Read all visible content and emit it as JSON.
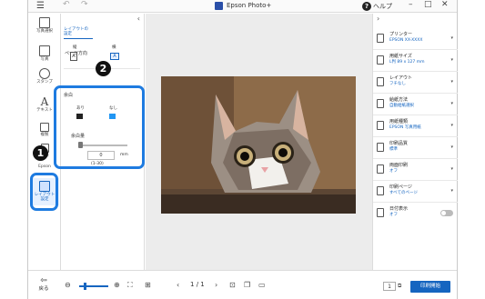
{
  "titlebar": {
    "app_title": "Epson Photo+",
    "help_label": "ヘルプ",
    "menu_icon": "hamburger-menu-icon",
    "undo_icon": "undo-icon",
    "redo_icon": "redo-icon"
  },
  "left_toolbar": {
    "items": [
      {
        "label": "写真選択",
        "icon": "photo-select-icon"
      },
      {
        "label": "写真",
        "icon": "photo-add-icon"
      },
      {
        "label": "スタンプ",
        "icon": "stamp-icon"
      },
      {
        "label": "テキスト",
        "icon": "text-icon"
      },
      {
        "label": "複製",
        "icon": "duplicate-icon"
      },
      {
        "label": "削除",
        "icon": "delete-icon"
      },
      {
        "label": "Epson",
        "icon": "epson-icon"
      },
      {
        "label": "レイアウト\n設定",
        "icon": "layout-settings-icon",
        "selected": true
      }
    ]
  },
  "settings_panel": {
    "tab_label": "レイアウトの\n設定",
    "orientation": {
      "title": "ページ方向",
      "portrait_label": "縦",
      "landscape_label": "横",
      "portrait_glyph": "A",
      "landscape_glyph": "A",
      "selected": "landscape"
    },
    "margin": {
      "title": "余白",
      "with_label": "あり",
      "without_label": "なし",
      "selected": "without"
    },
    "margin_amount": {
      "title": "余白量",
      "value": "0",
      "unit": "mm",
      "range": "(1-30)"
    }
  },
  "right_panel": {
    "items": [
      {
        "title": "プリンター",
        "value": "EPSON XX-XXXX",
        "icon": "printer-icon"
      },
      {
        "title": "用紙サイズ",
        "value": "L判 89 x 127 mm",
        "icon": "paper-size-icon"
      },
      {
        "title": "レイアウト",
        "value": "フチなし",
        "icon": "layout-icon"
      },
      {
        "title": "給紙方法",
        "value": "自動給紙選択",
        "icon": "paper-feed-icon"
      },
      {
        "title": "用紙種類",
        "value": "EPSON 写真用紙",
        "icon": "paper-type-icon"
      },
      {
        "title": "印刷品質",
        "value": "標準",
        "icon": "print-quality-icon"
      },
      {
        "title": "両面印刷",
        "value": "オフ",
        "icon": "duplex-icon"
      },
      {
        "title": "印刷ページ",
        "value": "すべてのページ",
        "icon": "print-pages-icon"
      },
      {
        "title": "日付表示",
        "value": "オフ",
        "icon": "date-icon",
        "toggle": false
      }
    ]
  },
  "bottom_bar": {
    "back_label": "戻る",
    "page_current": "1",
    "page_sep": "/",
    "page_total": "1",
    "copies": "1",
    "print_button": "印刷開始"
  },
  "annotations": {
    "badge_1": "1",
    "badge_2": "2",
    "highlight_color": "#1e7be0"
  },
  "colors": {
    "accent": "#1565c0",
    "canvas_bg": "#ececec"
  }
}
